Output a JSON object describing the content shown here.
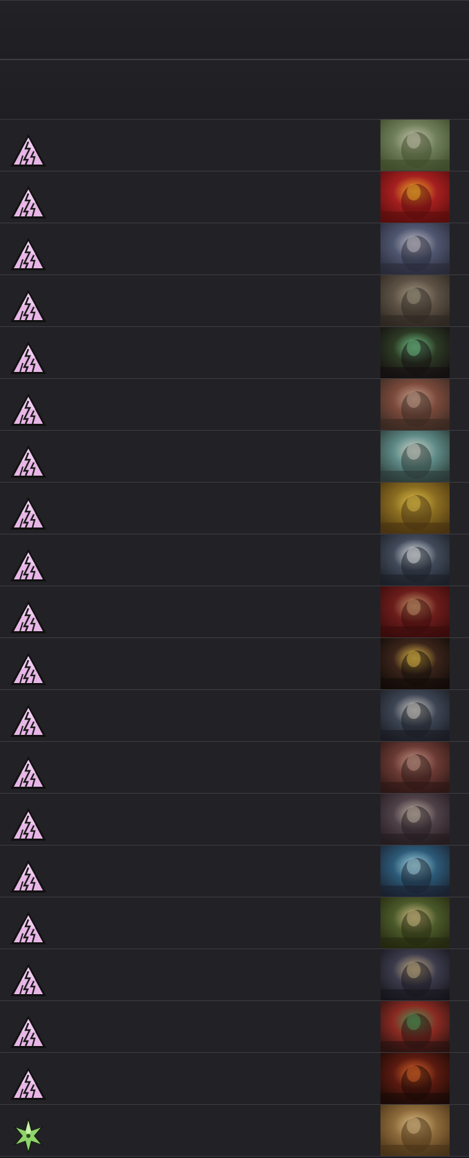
{
  "header": {
    "bands": 2
  },
  "rows": [
    {
      "icon": "pyramid-rune-icon",
      "icon_color": "#e7b6e6",
      "art": {
        "name": "swamp-troll-art",
        "c1": "#6f7f5a",
        "c2": "#c9c7b1",
        "c3": "#3f4c2c"
      }
    },
    {
      "icon": "pyramid-rune-icon",
      "icon_color": "#e7b6e6",
      "art": {
        "name": "fire-fist-art",
        "c1": "#a51f1f",
        "c2": "#f2b32a",
        "c3": "#5b0d0d"
      }
    },
    {
      "icon": "pyramid-rune-icon",
      "icon_color": "#e7b6e6",
      "art": {
        "name": "shadow-wraith-art",
        "c1": "#4f5670",
        "c2": "#c7c4cc",
        "c3": "#2a2b3a"
      }
    },
    {
      "icon": "pyramid-rune-icon",
      "icon_color": "#e7b6e6",
      "art": {
        "name": "bone-spikes-art",
        "c1": "#5d5245",
        "c2": "#a59b86",
        "c3": "#2f2822"
      }
    },
    {
      "icon": "pyramid-rune-icon",
      "icon_color": "#e7b6e6",
      "art": {
        "name": "spider-swarm-art",
        "c1": "#2c3a24",
        "c2": "#74c98a",
        "c3": "#140f10"
      }
    },
    {
      "icon": "pyramid-rune-icon",
      "icon_color": "#e7b6e6",
      "art": {
        "name": "red-dress-witch-art",
        "c1": "#7b4a3c",
        "c2": "#caa38f",
        "c3": "#3b2a22"
      }
    },
    {
      "icon": "pyramid-rune-icon",
      "icon_color": "#e7b6e6",
      "art": {
        "name": "mist-warriors-art",
        "c1": "#5e8a86",
        "c2": "#d5d9cf",
        "c3": "#2b3a37"
      }
    },
    {
      "icon": "pyramid-rune-icon",
      "icon_color": "#e7b6e6",
      "art": {
        "name": "gold-hoard-art",
        "c1": "#8b6d21",
        "c2": "#e1c24a",
        "c3": "#4a3410"
      }
    },
    {
      "icon": "pyramid-rune-icon",
      "icon_color": "#e7b6e6",
      "art": {
        "name": "grey-ghoul-art",
        "c1": "#414a5a",
        "c2": "#e8ecf0",
        "c3": "#1c2028"
      }
    },
    {
      "icon": "pyramid-rune-icon",
      "icon_color": "#e7b6e6",
      "art": {
        "name": "crimson-brute-art",
        "c1": "#6b1d1b",
        "c2": "#c89a6c",
        "c3": "#3a0b0b"
      }
    },
    {
      "icon": "pyramid-rune-icon",
      "icon_color": "#e7b6e6",
      "art": {
        "name": "golden-halo-art",
        "c1": "#3a241a",
        "c2": "#e9c04a",
        "c3": "#120c09"
      }
    },
    {
      "icon": "pyramid-rune-icon",
      "icon_color": "#e7b6e6",
      "art": {
        "name": "pale-reader-art",
        "c1": "#3d4554",
        "c2": "#d7d2cc",
        "c3": "#1a1d24"
      }
    },
    {
      "icon": "pyramid-rune-icon",
      "icon_color": "#e7b6e6",
      "art": {
        "name": "fallen-body-art",
        "c1": "#6b3a34",
        "c2": "#c79a8a",
        "c3": "#2e1715"
      }
    },
    {
      "icon": "pyramid-rune-icon",
      "icon_color": "#e7b6e6",
      "art": {
        "name": "hooded-hunter-art",
        "c1": "#4f4148",
        "c2": "#c6b7a8",
        "c3": "#241c20"
      }
    },
    {
      "icon": "pyramid-rune-icon",
      "icon_color": "#e7b6e6",
      "art": {
        "name": "spirit-hands-art",
        "c1": "#2c5a78",
        "c2": "#a8dbe8",
        "c3": "#1a2230"
      }
    },
    {
      "icon": "pyramid-rune-icon",
      "icon_color": "#e7b6e6",
      "art": {
        "name": "forest-elder-art",
        "c1": "#4b5a2a",
        "c2": "#d8c38a",
        "c3": "#24280f"
      }
    },
    {
      "icon": "pyramid-rune-icon",
      "icon_color": "#e7b6e6",
      "art": {
        "name": "dark-temple-art",
        "c1": "#3c3b4c",
        "c2": "#c9b386",
        "c3": "#17161d"
      }
    },
    {
      "icon": "pyramid-rune-icon",
      "icon_color": "#e7b6e6",
      "art": {
        "name": "green-knights-art",
        "c1": "#8a2a22",
        "c2": "#4f9a58",
        "c3": "#2a1210"
      }
    },
    {
      "icon": "pyramid-rune-icon",
      "icon_color": "#e7b6e6",
      "art": {
        "name": "lava-maw-art",
        "c1": "#5a1a10",
        "c2": "#e0672a",
        "c3": "#1b0a06"
      }
    },
    {
      "icon": "green-star-rune-icon",
      "icon_color": "#8fd46a",
      "art": {
        "name": "sand-idol-art",
        "c1": "#8d6a3a",
        "c2": "#e0c28a",
        "c3": "#4a3318"
      }
    }
  ]
}
